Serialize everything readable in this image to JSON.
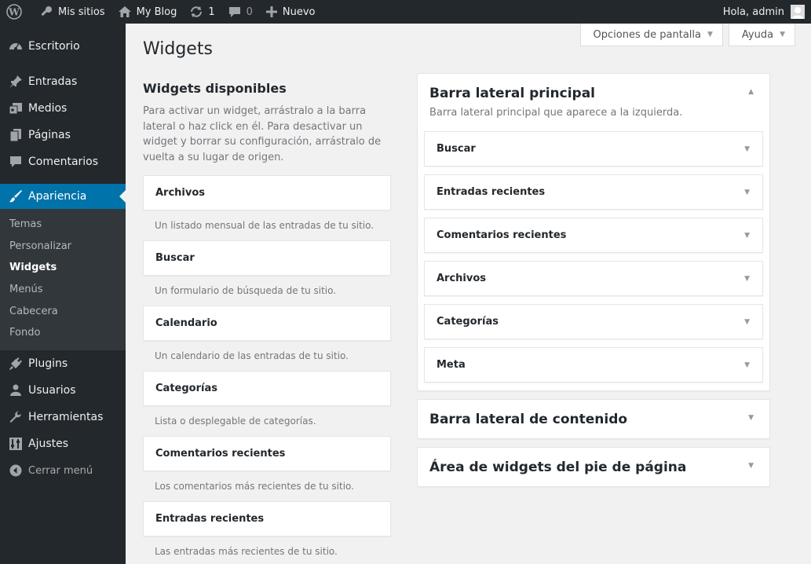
{
  "adminbar": {
    "my_sites": "Mis sitios",
    "site_name": "My Blog",
    "updates_count": "1",
    "comments_count": "0",
    "new_label": "Nuevo",
    "greeting": "Hola, admin"
  },
  "sidebar": {
    "items_top": [
      {
        "label": "Escritorio",
        "icon": "dashboard-icon"
      }
    ],
    "items_mid": [
      {
        "label": "Entradas",
        "icon": "pin-icon"
      },
      {
        "label": "Medios",
        "icon": "media-icon"
      },
      {
        "label": "Páginas",
        "icon": "pages-icon"
      },
      {
        "label": "Comentarios",
        "icon": "comment-icon"
      }
    ],
    "current": {
      "label": "Apariencia",
      "icon": "paintbrush-icon"
    },
    "submenu": [
      "Temas",
      "Personalizar",
      "Widgets",
      "Menús",
      "Cabecera",
      "Fondo"
    ],
    "submenu_active": "Widgets",
    "items_bottom": [
      {
        "label": "Plugins",
        "icon": "plug-icon"
      },
      {
        "label": "Usuarios",
        "icon": "user-icon"
      },
      {
        "label": "Herramientas",
        "icon": "wrench-icon"
      },
      {
        "label": "Ajustes",
        "icon": "settings-icon"
      }
    ],
    "collapse_label": "Cerrar menú"
  },
  "screen_tabs": {
    "options": "Opciones de pantalla",
    "help": "Ayuda"
  },
  "page_title": "Widgets",
  "available": {
    "title": "Widgets disponibles",
    "description": "Para activar un widget, arrástralo a la barra lateral o haz click en él. Para desactivar un widget y borrar su configuración, arrástralo de vuelta a su lugar de origen.",
    "widgets": [
      {
        "name": "Archivos",
        "desc": "Un listado mensual de las entradas de tu sitio."
      },
      {
        "name": "Buscar",
        "desc": "Un formulario de búsqueda de tu sitio."
      },
      {
        "name": "Calendario",
        "desc": "Un calendario de las entradas de tu sitio."
      },
      {
        "name": "Categorías",
        "desc": "Lista o desplegable de categorías."
      },
      {
        "name": "Comentarios recientes",
        "desc": "Los comentarios más recientes de tu sitio."
      },
      {
        "name": "Entradas recientes",
        "desc": "Las entradas más recientes de tu sitio."
      }
    ]
  },
  "sidebars": [
    {
      "title": "Barra lateral principal",
      "description": "Barra lateral principal que aparece a la izquierda.",
      "expanded": true,
      "widgets": [
        "Buscar",
        "Entradas recientes",
        "Comentarios recientes",
        "Archivos",
        "Categorías",
        "Meta"
      ]
    },
    {
      "title": "Barra lateral de contenido",
      "expanded": false
    },
    {
      "title": "Área de widgets del pie de página",
      "expanded": false
    }
  ]
}
